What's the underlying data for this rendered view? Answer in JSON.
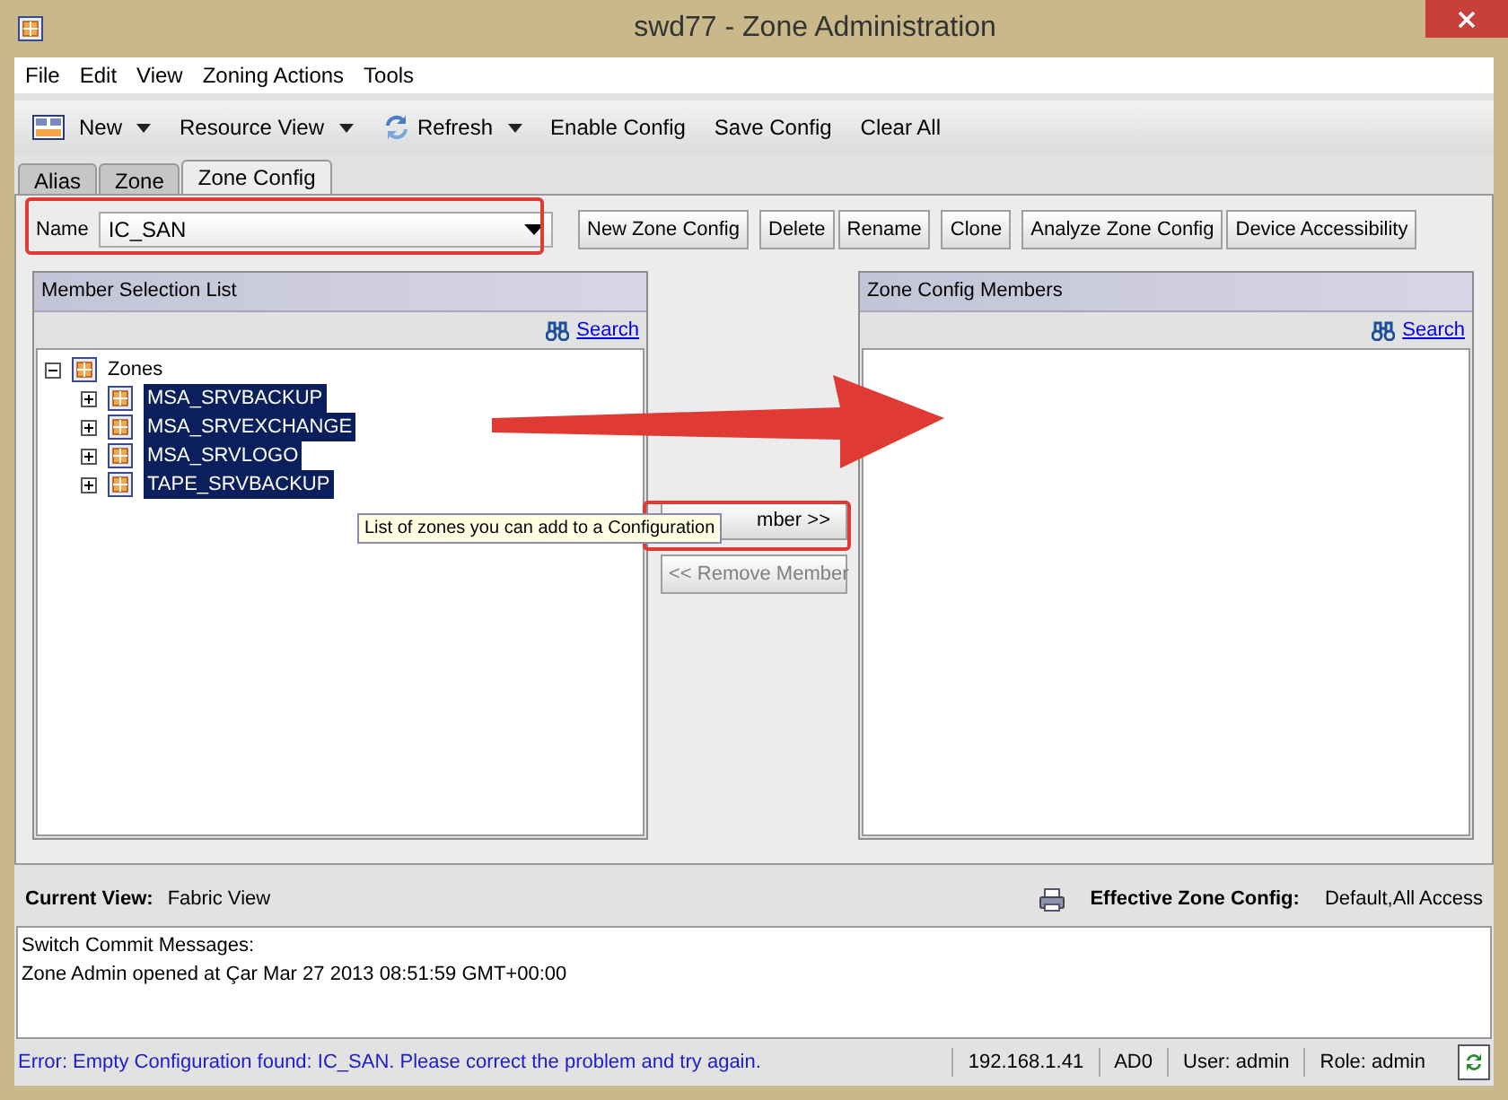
{
  "window": {
    "title": "swd77 - Zone Administration"
  },
  "menu": [
    "File",
    "Edit",
    "View",
    "Zoning Actions",
    "Tools"
  ],
  "toolbar": [
    {
      "label": "New",
      "kind": "icon-dropdown"
    },
    {
      "label": "Resource View",
      "kind": "dropdown"
    },
    {
      "label": "Refresh",
      "kind": "icon-dropdown"
    },
    {
      "label": "Enable Config",
      "kind": "plain"
    },
    {
      "label": "Save Config",
      "kind": "plain"
    },
    {
      "label": "Clear All",
      "kind": "plain"
    }
  ],
  "tabs": [
    {
      "label": "Alias",
      "selected": false
    },
    {
      "label": "Zone",
      "selected": false
    },
    {
      "label": "Zone Config",
      "selected": true
    }
  ],
  "name_field": {
    "label": "Name",
    "value": "IC_SAN"
  },
  "actions": [
    "New Zone Config",
    "Delete",
    "Rename",
    "Clone",
    "Analyze Zone Config",
    "Device Accessibility"
  ],
  "left_panel": {
    "title": "Member Selection List",
    "search": "Search",
    "tree": {
      "label": "Zones",
      "expanded": true,
      "children": [
        {
          "label": "MSA_SRVBACKUP",
          "selected": true
        },
        {
          "label": "MSA_SRVEXCHANGE",
          "selected": true
        },
        {
          "label": "MSA_SRVLOGO",
          "selected": true
        },
        {
          "label": "TAPE_SRVBACKUP",
          "selected": true
        }
      ]
    }
  },
  "add_button": {
    "label": "mber >>",
    "disabled": false
  },
  "remove_button": {
    "label": "<< Remove Member",
    "disabled": true
  },
  "tooltip": "List of zones you can add to a Configuration",
  "right_panel": {
    "title": "Zone Config Members",
    "search": "Search"
  },
  "view_bar": {
    "current_view_label": "Current View:",
    "current_view": "Fabric View",
    "effective_label": "Effective Zone Config:",
    "effective": "Default,All Access"
  },
  "messages": [
    "Switch Commit Messages:",
    "Zone Admin opened at Çar Mar 27 2013 08:51:59 GMT+00:00"
  ],
  "status_bar": {
    "error": "Error: Empty Configuration found: IC_SAN. Please correct the problem and try again.",
    "fields": [
      "192.168.1.41",
      "AD0",
      "User: admin",
      "Role: admin"
    ]
  }
}
